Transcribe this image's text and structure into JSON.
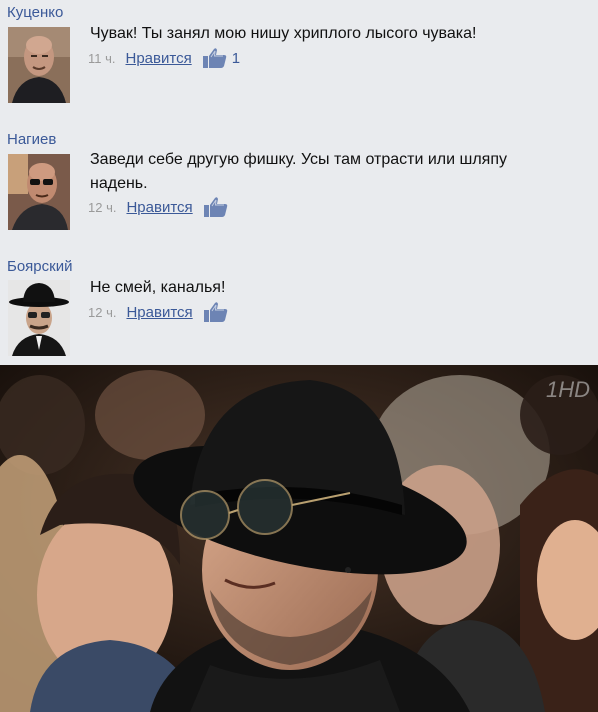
{
  "comments": [
    {
      "author": "Куценко",
      "text": "Чувак! Ты занял мою нишу хриплого лысого чувака!",
      "time": "11 ч.",
      "like_label": "Нравится",
      "like_count": "1",
      "avatar_icon": "avatar-bald-man"
    },
    {
      "author": "Нагиев",
      "text": "Заведи себе другую фишку. Усы там отрасти или шляпу надень.",
      "time": "12 ч.",
      "like_label": "Нравится",
      "like_count": "",
      "avatar_icon": "avatar-bald-man-sunglasses"
    },
    {
      "author": "Боярский",
      "text": "Не смей, каналья!",
      "time": "12 ч.",
      "like_label": "Нравится",
      "like_count": "",
      "avatar_icon": "avatar-man-black-hat"
    }
  ],
  "photo": {
    "channel_logo": "1HD",
    "subject": "man-in-black-hat-and-glasses-in-audience"
  },
  "colors": {
    "link": "#3b5998",
    "background": "#e9ebee",
    "meta": "#999999"
  }
}
